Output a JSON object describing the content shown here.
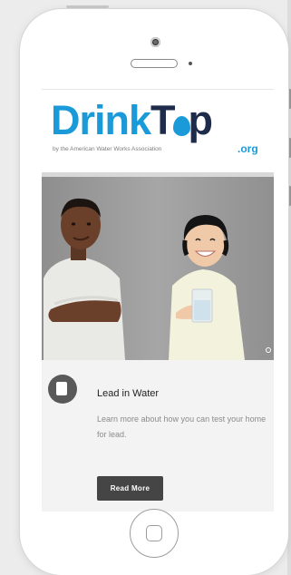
{
  "logo": {
    "word_part1": "Drink",
    "word_part2": "T",
    "word_part3": "p",
    "tagline": "by the American Water Works Association",
    "suffix": ".org",
    "brand_color": "#1a9ad8",
    "dark_color": "#1e2b4a"
  },
  "card": {
    "icon": "document-icon",
    "title": "Lead in Water",
    "description": "Learn more about how you can test your home for lead.",
    "button_label": "Read More",
    "button_color": "#454545"
  },
  "colors": {
    "page_background": "#ececec",
    "phone_body": "#ffffff",
    "card_background": "#f3f3f3"
  }
}
